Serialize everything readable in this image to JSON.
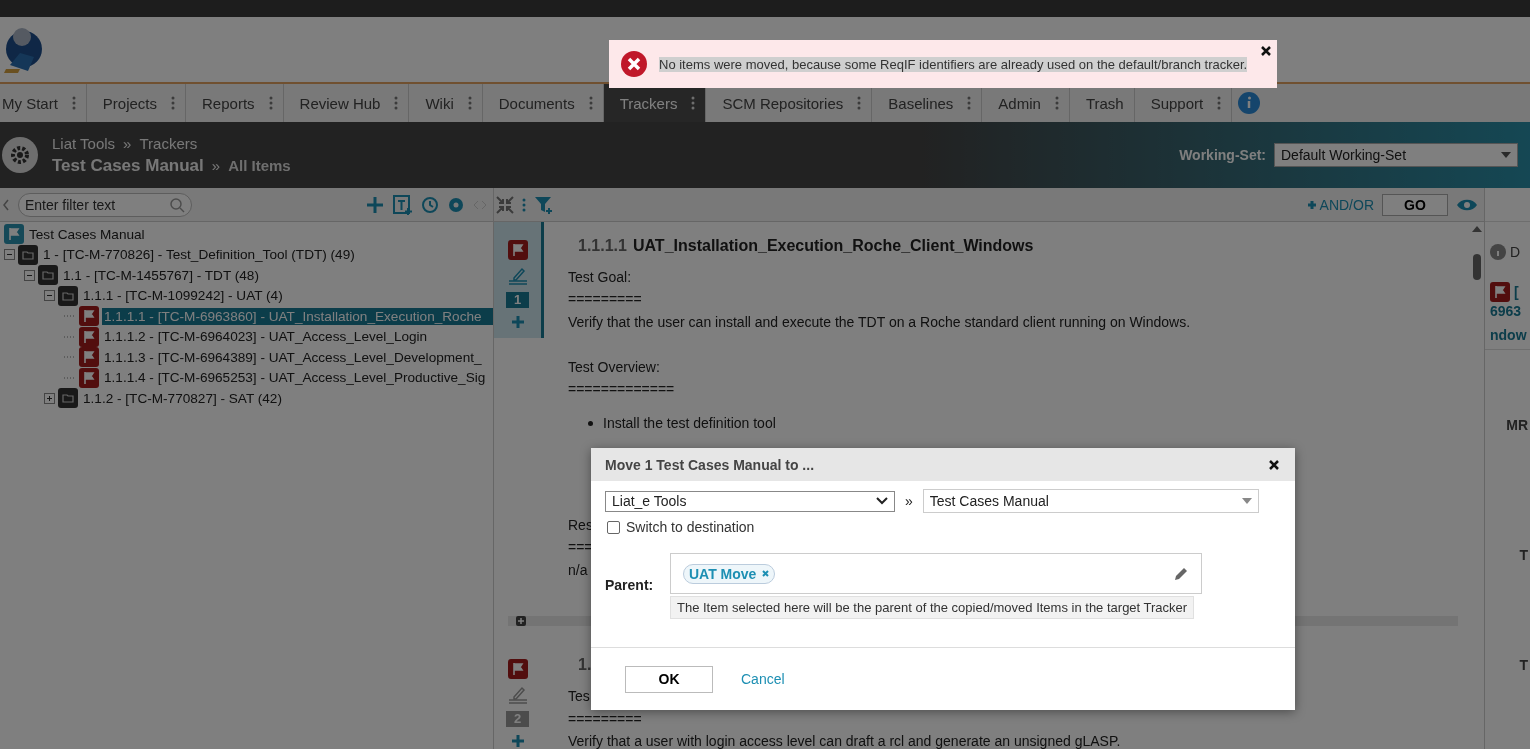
{
  "notification": {
    "message": "No items were moved, because some ReqIF identifiers are already used on the default/branch tracker."
  },
  "tabs": [
    {
      "label": "My Start",
      "selected": false,
      "menu": true
    },
    {
      "label": "Projects",
      "selected": false,
      "menu": true
    },
    {
      "label": "Reports",
      "selected": false,
      "menu": true
    },
    {
      "label": "Review Hub",
      "selected": false,
      "menu": true
    },
    {
      "label": "Wiki",
      "selected": false,
      "menu": true
    },
    {
      "label": "Documents",
      "selected": false,
      "menu": true
    },
    {
      "label": "Trackers",
      "selected": true,
      "menu": true
    },
    {
      "label": "SCM Repositories",
      "selected": false,
      "menu": true
    },
    {
      "label": "Baselines",
      "selected": false,
      "menu": true
    },
    {
      "label": "Admin",
      "selected": false,
      "menu": true
    },
    {
      "label": "Trash",
      "selected": false,
      "menu": false
    },
    {
      "label": "Support",
      "selected": false,
      "menu": true
    }
  ],
  "breadcrumb": {
    "project": "Liat Tools",
    "separator": "»",
    "section": "Trackers",
    "tracker": "Test Cases Manual",
    "view": "All Items"
  },
  "working_set": {
    "label": "Working-Set:",
    "value": "Default Working-Set"
  },
  "filter": {
    "placeholder": "Enter filter text"
  },
  "tree": {
    "root": "Test Cases Manual",
    "items": [
      {
        "kind": "folder",
        "label": "1 - [TC-M-770826] - Test_Definition_Tool (TDT) (49)",
        "expanded": true,
        "children": [
          {
            "kind": "folder",
            "label": "1.1 - [TC-M-1455767] - TDT (48)",
            "expanded": true,
            "children": [
              {
                "kind": "folder",
                "label": "1.1.1 - [TC-M-1099242] - UAT (4)",
                "expanded": true,
                "children": [
                  {
                    "kind": "item",
                    "label": "1.1.1.1 - [TC-M-6963860] - UAT_Installation_Execution_Roche",
                    "selected": true
                  },
                  {
                    "kind": "item",
                    "label": "1.1.1.2 - [TC-M-6964023] - UAT_Access_Level_Login",
                    "selected": false
                  },
                  {
                    "kind": "item",
                    "label": "1.1.1.3 - [TC-M-6964389] - UAT_Access_Level_Development_",
                    "selected": false
                  },
                  {
                    "kind": "item",
                    "label": "1.1.1.4 - [TC-M-6965253] - UAT_Access_Level_Productive_Sig",
                    "selected": false
                  }
                ]
              },
              {
                "kind": "folder",
                "label": "1.1.2 - [TC-M-770827] - SAT (42)",
                "expanded": false
              }
            ]
          }
        ]
      }
    ]
  },
  "query": {
    "and_or": "AND/OR",
    "go": "GO"
  },
  "items": [
    {
      "count": "1",
      "active": true,
      "number": "1.1.1.1",
      "title": "UAT_Installation_Execution_Roche_Client_Windows",
      "lines": [
        {
          "kind": "text",
          "text": "Test Goal:"
        },
        {
          "kind": "text",
          "text": "========="
        },
        {
          "kind": "text",
          "text": "Verify that the user can install and execute the TDT on a Roche standard client running on Windows."
        },
        {
          "kind": "gap"
        },
        {
          "kind": "text",
          "text": "Test Overview:"
        },
        {
          "kind": "text",
          "text": "============="
        },
        {
          "kind": "bullet",
          "text": "Install the test definition tool"
        },
        {
          "kind": "gap"
        },
        {
          "kind": "gap"
        },
        {
          "kind": "gap"
        },
        {
          "kind": "text",
          "text": "Res"
        },
        {
          "kind": "text",
          "text": "==="
        },
        {
          "kind": "text",
          "text": "n/a"
        }
      ]
    },
    {
      "count": "2",
      "active": false,
      "number": "1.",
      "lines": [
        {
          "kind": "text",
          "text": "Tes"
        },
        {
          "kind": "text",
          "text": "========="
        },
        {
          "kind": "text",
          "text": "Verify that a user with login access level can draft a rcl and generate an unsigned gLASP."
        }
      ]
    }
  ],
  "right_panel": {
    "info": "D",
    "item_ref": "[",
    "item_id": "6963",
    "item_name": "ndow",
    "fields": [
      "MR",
      "T",
      "T"
    ]
  },
  "dialog": {
    "title": "Move 1 Test Cases Manual to ...",
    "project": "Liat_e Tools",
    "separator": "»",
    "tracker": "Test Cases Manual",
    "switch_label": "Switch to destination",
    "switch_checked": false,
    "parent_label": "Parent:",
    "parent_token": "UAT Move",
    "parent_hint": "The Item selected here will be the parent of the copied/moved Items in the target Tracker",
    "ok": "OK",
    "cancel": "Cancel"
  }
}
